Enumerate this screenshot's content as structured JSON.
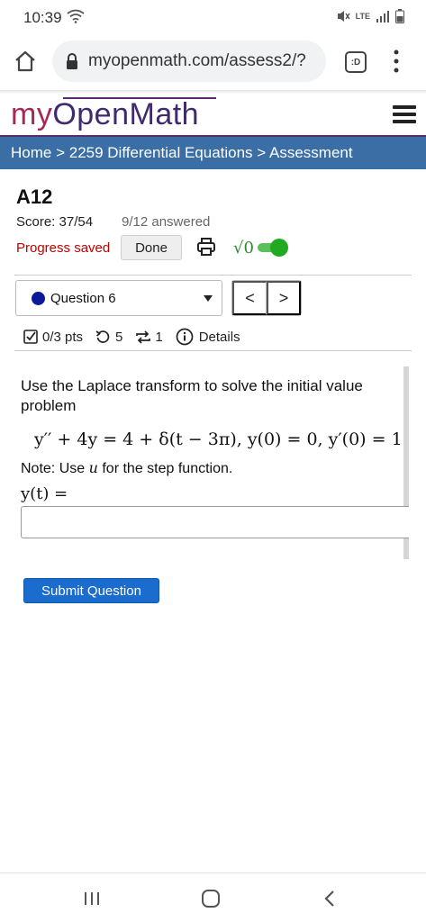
{
  "status": {
    "time": "10:39",
    "network": "LTE"
  },
  "browser": {
    "url": "myopenmath.com/assess2/?"
  },
  "site": {
    "logo_my": "my",
    "logo_rest": "OpenMath"
  },
  "breadcrumb": {
    "home": "Home",
    "sep1": " > ",
    "course": "2259 Differential Equations",
    "sep2": " > ",
    "current": "Assessment"
  },
  "assessment": {
    "title": "A12",
    "score": "Score: 37/54",
    "answered": "9/12 answered",
    "progress_status": "Progress saved",
    "done_label": "Done",
    "math_toggle_label": "√0"
  },
  "question_nav": {
    "selected": "Question 6",
    "prev": "<",
    "next": ">"
  },
  "question_info": {
    "points": "0/3 pts",
    "attempts": "5",
    "regens": "1",
    "details": "Details"
  },
  "question": {
    "prompt": "Use the Laplace transform to solve the initial value problem",
    "equation": "y′′ + 4y = 4 + δ(t − 3π),  y(0) = 0, y′(0) = 1",
    "note_prefix": "Note: Use ",
    "note_var": "u",
    "note_suffix": " for the step function.",
    "answer_label": "y(t) =",
    "answer_value": ""
  },
  "actions": {
    "submit_label": "Submit Question"
  },
  "colors": {
    "breadcrumb_bg": "#3a6ea5",
    "progress_saved": "#c40000",
    "submit_bg": "#1a6ccf",
    "question_dot": "#0b1a99",
    "toggle": "#1faa1f"
  }
}
